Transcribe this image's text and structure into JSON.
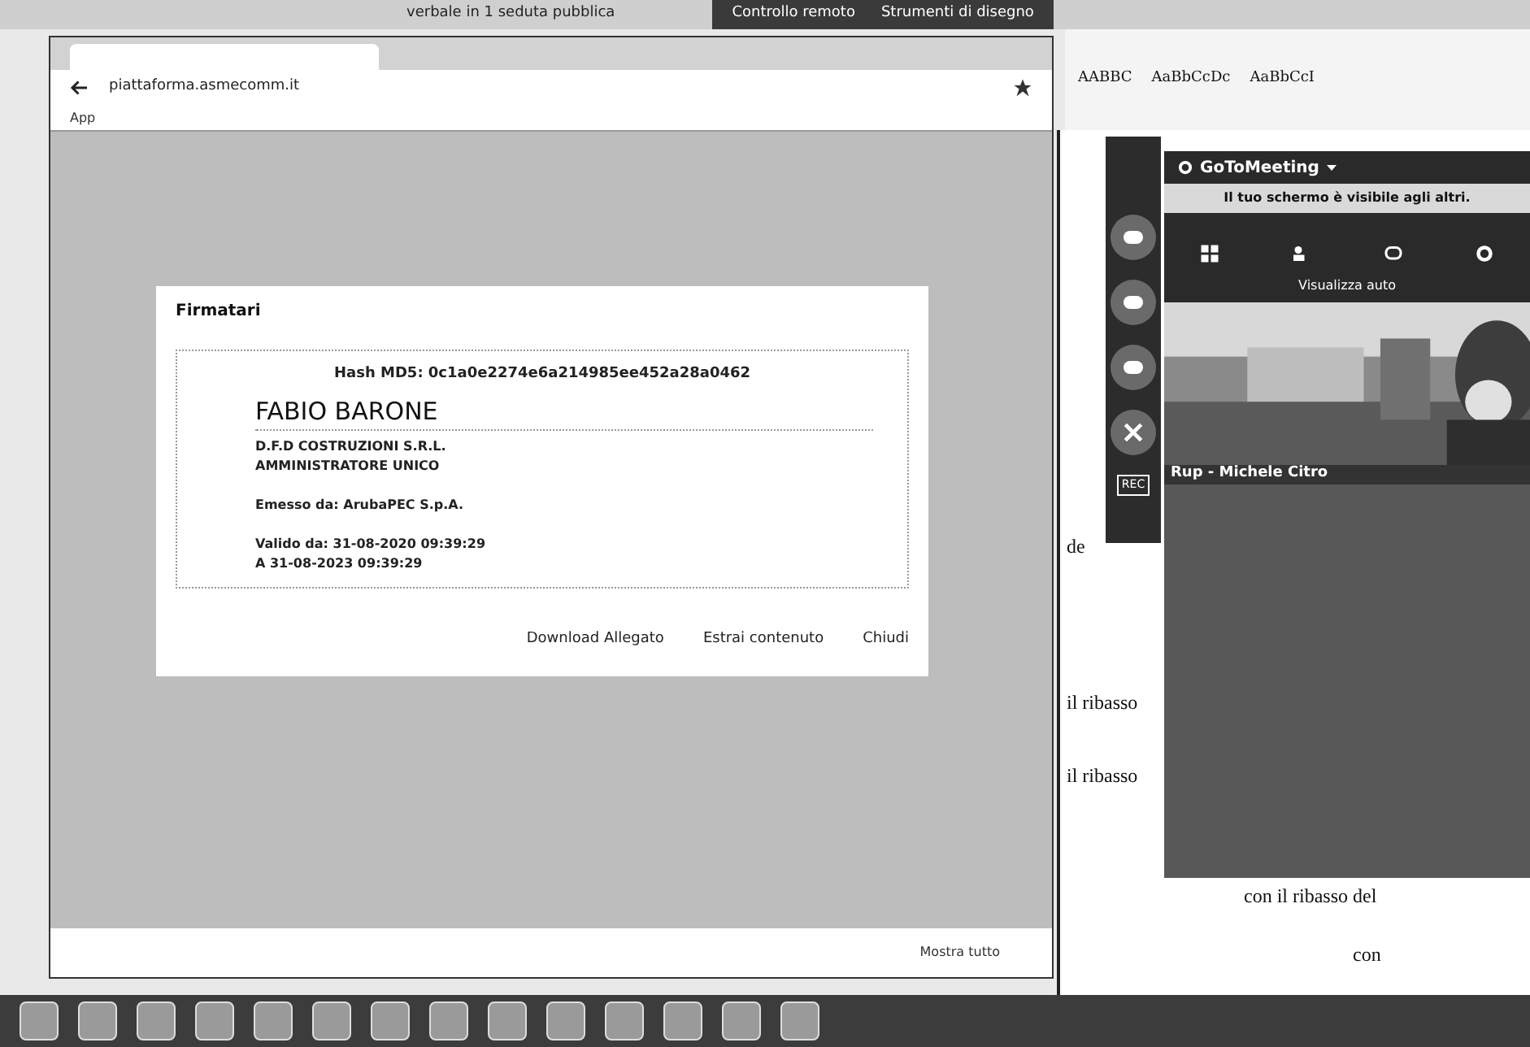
{
  "top_bar": {
    "title": "verbale in 1 seduta pubblica",
    "menus": [
      "Controllo remoto",
      "Strumenti di disegno"
    ]
  },
  "browser": {
    "address": "piattaforma.asmecomm.it",
    "bookmarks": [
      "App"
    ],
    "download_bar": {
      "action": "Mostra tutto"
    }
  },
  "dialog": {
    "title": "Firmatari",
    "hash": "Hash MD5: 0c1a0e2274e6a214985ee452a28a0462",
    "signer": "FABIO BARONE",
    "lines": [
      "D.F.D COSTRUZIONI S.R.L.",
      "AMMINISTRATORE UNICO"
    ],
    "issuer": "Emesso da: ArubaPEC S.p.A.",
    "validity": [
      "Valido da: 31-08-2020 09:39:29",
      "A 31-08-2023 09:39:29"
    ],
    "buttons": [
      "Download Allegato",
      "Estrai contenuto",
      "Chiudi"
    ]
  },
  "word": {
    "styles": [
      "AABBC",
      "AaBbCcDc",
      "AaBbCcI"
    ],
    "document_lines": [
      "de",
      "il ribasso",
      "il ribasso",
      "con il ribasso del",
      "con"
    ]
  },
  "meeting": {
    "title": "GoToMeeting",
    "banner": "Il tuo schermo è visibile agli altri.",
    "view": "Visualizza auto",
    "participant": "Rup - Michele Citro",
    "rec": "REC"
  }
}
